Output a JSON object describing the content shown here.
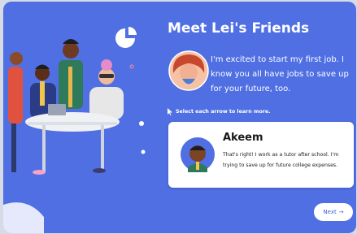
{
  "page": {
    "title": "Meet Lei's Friends",
    "lei_quote": "I'm excited to start my first job. I know you all have jobs to save up for your future, too.",
    "instruction": "Select each arrow to learn more.",
    "friend_card": {
      "name": "Akeem",
      "text": "That's right! I work as a tutor after school. I'm trying to save up for future college expenses."
    },
    "next_label": "Next",
    "next_arrow": "→"
  },
  "colors": {
    "background": "#4f6fe3",
    "card": "#ffffff",
    "button_text": "#3d5fd6"
  },
  "icons": {
    "pointer": "cursor-pointer-icon",
    "pie": "pie-chart-icon",
    "next": "arrow-right-icon"
  }
}
